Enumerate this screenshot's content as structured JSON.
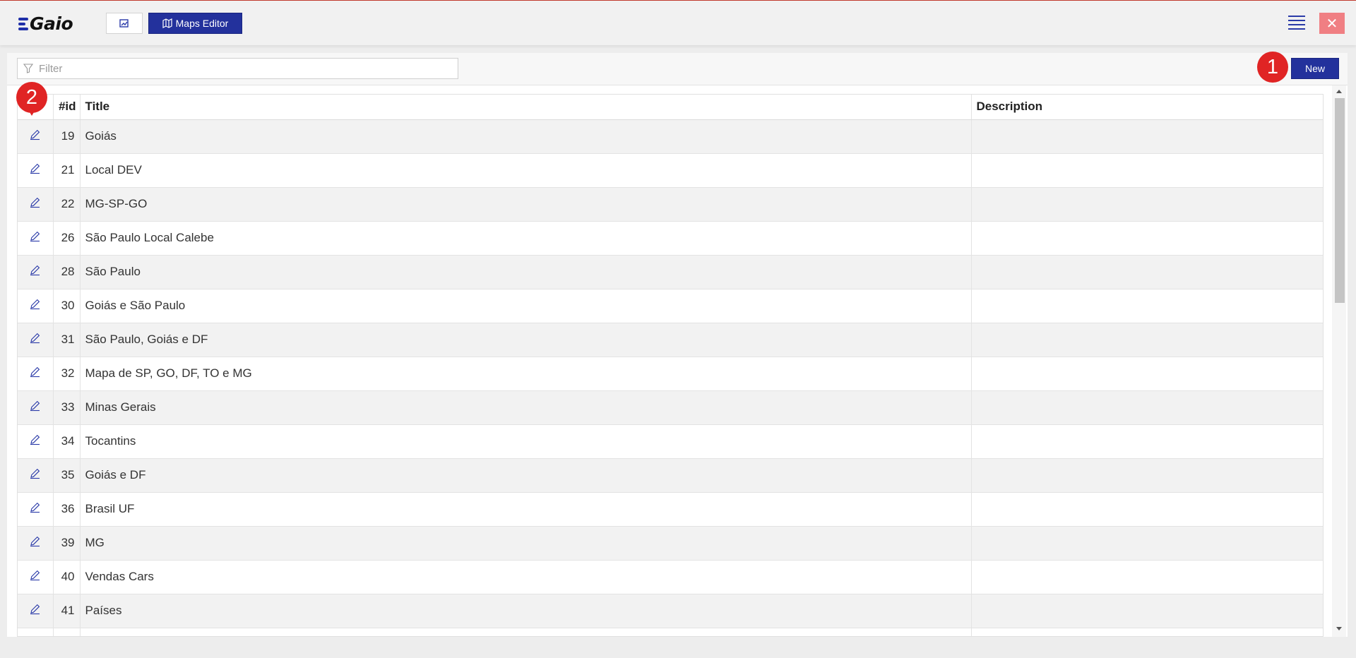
{
  "app": {
    "logo_text": "Gaio"
  },
  "topbar": {
    "maps_editor_label": "Maps Editor",
    "menu_icon": "hamburger-menu-icon",
    "close_icon": "close-icon"
  },
  "toolbar": {
    "filter_placeholder": "Filter",
    "new_label": "New"
  },
  "badges": {
    "one": "1",
    "two": "2"
  },
  "table": {
    "columns": [
      "",
      "#id",
      "Title",
      "Description"
    ],
    "rows": [
      {
        "id": "19",
        "title": "Goiás",
        "description": ""
      },
      {
        "id": "21",
        "title": "Local DEV",
        "description": ""
      },
      {
        "id": "22",
        "title": "MG-SP-GO",
        "description": ""
      },
      {
        "id": "26",
        "title": "São Paulo Local Calebe",
        "description": ""
      },
      {
        "id": "28",
        "title": "São Paulo",
        "description": ""
      },
      {
        "id": "30",
        "title": "Goiás e São Paulo",
        "description": ""
      },
      {
        "id": "31",
        "title": "São Paulo, Goiás e DF",
        "description": ""
      },
      {
        "id": "32",
        "title": "Mapa de SP, GO, DF, TO e MG",
        "description": ""
      },
      {
        "id": "33",
        "title": "Minas Gerais",
        "description": ""
      },
      {
        "id": "34",
        "title": "Tocantins",
        "description": ""
      },
      {
        "id": "35",
        "title": "Goiás e DF",
        "description": ""
      },
      {
        "id": "36",
        "title": "Brasil UF",
        "description": ""
      },
      {
        "id": "39",
        "title": "MG",
        "description": ""
      },
      {
        "id": "40",
        "title": "Vendas Cars",
        "description": ""
      },
      {
        "id": "41",
        "title": "Países",
        "description": ""
      },
      {
        "id": "",
        "title": "",
        "description": ""
      }
    ]
  },
  "colors": {
    "accent": "#23319c",
    "badge": "#e02424",
    "close": "#f07f83"
  }
}
